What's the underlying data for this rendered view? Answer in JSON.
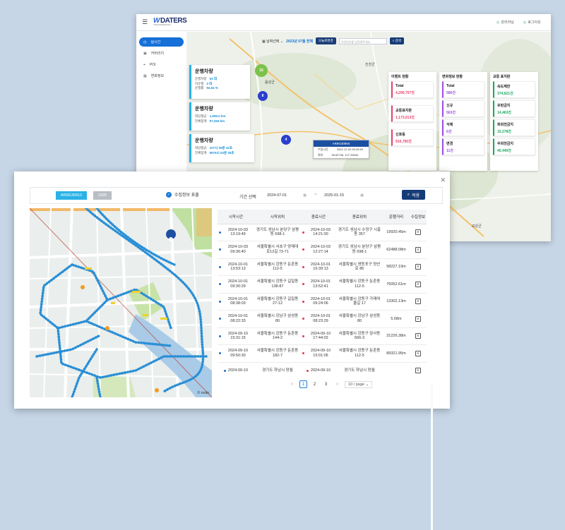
{
  "app": {
    "menu_icon": "hamburger-icon",
    "logo_text": "DATERS",
    "logo_sub": "SAFE DATA RESEARCH",
    "top_links": [
      {
        "label": "관리자님",
        "icon": "user-icon"
      },
      {
        "label": "로그아웃",
        "icon": "logout-icon"
      }
    ]
  },
  "sidebar": {
    "items": [
      {
        "label": "실시간",
        "icon": "clock-icon",
        "active": true
      },
      {
        "label": "커버리지",
        "icon": "coverage-icon",
        "active": false
      },
      {
        "label": "POI",
        "icon": "poi-icon",
        "active": false
      },
      {
        "label": "변화정보",
        "icon": "change-icon",
        "active": false
      }
    ]
  },
  "filter": {
    "period_select": "날짜선택",
    "period_value": "2023년 07월 전체",
    "today_button": "오늘로변경",
    "search_placeholder": "차량번호를 입력해주세요",
    "search_button": "검색"
  },
  "vehicle_cards": [
    {
      "title": "운행차량",
      "rows": [
        {
          "label": "운행차량",
          "value": "53 대"
        },
        {
          "label": "미운행",
          "value": "3 대"
        },
        {
          "label": "운행률",
          "value": "94.64 %"
        }
      ]
    },
    {
      "title": "운행차량",
      "rows": [
        {
          "label": "대당평균",
          "value": "1,835.0 km"
        },
        {
          "label": "전체합계",
          "value": "97,264 km"
        }
      ]
    },
    {
      "title": "운행차량",
      "rows": [
        {
          "label": "대당평균",
          "value": "107시 05분 42초"
        },
        {
          "label": "전체합계",
          "value": "5676시 02분 26초"
        }
      ]
    }
  ],
  "stat_columns": [
    {
      "title": "이벤트 현황",
      "items": [
        {
          "label": "Total",
          "value": "4,290,757건",
          "color": "#e8416b"
        },
        {
          "label": "교통표지판",
          "value": "1,173,013건",
          "color": "#e8416b"
        },
        {
          "label": "신호등",
          "value": "910,790건",
          "color": "#e8416b"
        }
      ]
    },
    {
      "title": "변화정보 현황",
      "items": [
        {
          "label": "Total",
          "value": "580건",
          "color": "#9b4fe0"
        },
        {
          "label": "신규",
          "value": "563건",
          "color": "#9b4fe0"
        },
        {
          "label": "삭제",
          "value": "6건",
          "color": "#9b4fe0"
        },
        {
          "label": "변경",
          "value": "11건",
          "color": "#9b4fe0"
        }
      ]
    },
    {
      "title": "교통 표지판",
      "items": [
        {
          "label": "속도제한",
          "value": "374,621건",
          "color": "#1aa85c"
        },
        {
          "label": "유턴금지",
          "value": "14,463건",
          "color": "#1aa85c"
        },
        {
          "label": "좌회전금지",
          "value": "15,278건",
          "color": "#1aa85c"
        },
        {
          "label": "우회전금지",
          "value": "40,449건",
          "color": "#1aa85c"
        }
      ]
    }
  ],
  "map_clusters": [
    {
      "count": "15",
      "color": "#7cc24a"
    },
    {
      "count": "8",
      "color": "#2a3fcf"
    },
    {
      "count": "4",
      "color": "#2a3fcf"
    }
  ],
  "map_popup": {
    "plate": "AR9G30904",
    "rows": [
      {
        "label": "수집시간",
        "value": "2024-12-20 05:49:45"
      },
      {
        "label": "위치",
        "value": "36.62796, 127.29634"
      }
    ]
  },
  "map_labels": [
    "진천군",
    "음성군",
    "보은군"
  ],
  "dialog": {
    "close_icon": "close-icon",
    "plate_main": "AR9G30912",
    "plate_sub": "1926",
    "collect_toggle": "수집정보 표출",
    "period_label": "기간 선택",
    "date_from": "2024-07-01",
    "date_tilde": "~",
    "date_to": "2025-01-15",
    "apply_button": "적용",
    "map_copyright": "© routo"
  },
  "trip_table": {
    "headers": [
      "시작시간",
      "시작위치",
      "종료시간",
      "종료위치",
      "운행거리",
      "수집정보"
    ],
    "rows": [
      {
        "start_time": "2024-10-03 13:19:49",
        "start_loc": "경기도 성남시 분당구 삼평동 698-1",
        "end_time": "2024-10-03 14:21:00",
        "end_loc": "경기도 성남시 수정구 시흥동 357",
        "distance": "19920.45m"
      },
      {
        "start_time": "2024-10-03 09:36:40",
        "start_loc": "서울특별시 서초구 양재대로12길 73-71",
        "end_time": "2024-10-03 12:27:14",
        "end_loc": "경기도 성남시 분당구 삼평동 698-1",
        "distance": "62488.08m"
      },
      {
        "start_time": "2024-10-01 13:53:13",
        "start_loc": "서울특별시 강동구 둔촌동 112-5",
        "end_time": "2024-10-01 16:39:13",
        "end_loc": "서울특별시 영등포구 양산로 86",
        "distance": "58227.19m"
      },
      {
        "start_time": "2024-10-01 09:30:29",
        "start_loc": "서울특별시 강동구 길일동 138-87",
        "end_time": "2024-10-01 13:52:41",
        "end_loc": "서울특별시 강동구 둔촌동 112-5",
        "distance": "76052.61m"
      },
      {
        "start_time": "2024-10-01 08:38:03",
        "start_loc": "서울특별시 강동구 길일동 27-12",
        "end_time": "2024-10-01 09:24:06",
        "end_loc": "서울특별시 강동구 가래여울길 17",
        "distance": "13302.13m"
      },
      {
        "start_time": "2024-10-01 08:22:33",
        "start_loc": "서울특별시 강남구 삼성동 80",
        "end_time": "2024-10-01 08:23:29",
        "end_loc": "서울특별시 강남구 삼성동 80",
        "distance": "5.08m"
      },
      {
        "start_time": "2024-09-10 15:31:15",
        "start_loc": "서울특별시 강동구 둔촌동 144-2",
        "end_time": "2024-09-10 17:44:02",
        "end_loc": "서울특별시 강동구 암사동 566-3",
        "distance": "31226.38m"
      },
      {
        "start_time": "2024-09-10 09:50:30",
        "start_loc": "서울특별시 강동구 둔촌동 182-7",
        "end_time": "2024-09-10 15:01:05",
        "end_loc": "서울특별시 강동구 둔촌동 112-5",
        "distance": "89321.95m"
      },
      {
        "start_time": "2024-09-10",
        "start_loc": "경기도 하남시 망월",
        "end_time": "2024-09-10",
        "end_loc": "경기도 하남시 망월",
        "distance": ""
      }
    ]
  },
  "pagination": {
    "prev": "<",
    "pages": [
      "1",
      "2",
      "3"
    ],
    "current": "1",
    "next": ">",
    "page_size": "10 / page"
  }
}
